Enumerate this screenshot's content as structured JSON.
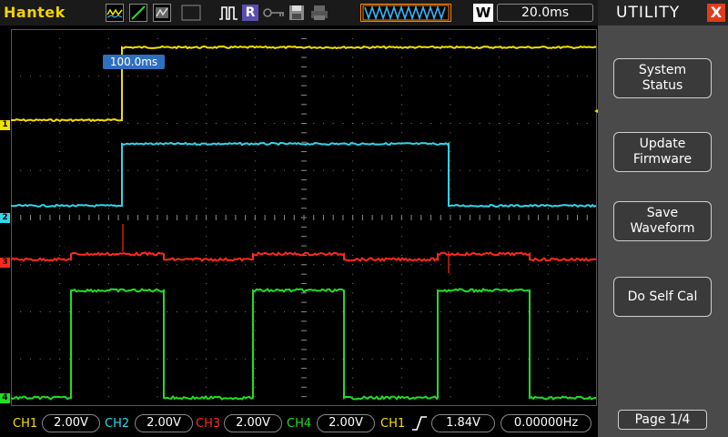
{
  "app": {
    "brand": "Hantek"
  },
  "toolbar": {
    "run_mode_label": "R",
    "w_label": "W",
    "timebase": "20.0ms"
  },
  "screen": {
    "trigger_position": "100.0ms",
    "channel_markers": [
      "1",
      "2",
      "3",
      "4"
    ]
  },
  "colors": {
    "ch1": "#f2e000",
    "ch2": "#2fd6ea",
    "ch3": "#ff2a1a",
    "ch4": "#22dd22"
  },
  "status": {
    "ch1_label": "CH1",
    "ch1_scale": "2.00V",
    "ch2_label": "CH2",
    "ch2_scale": "2.00V",
    "ch3_label": "CH3",
    "ch3_scale": "2.00V",
    "ch4_label": "CH4",
    "ch4_scale": "2.00V",
    "trigger_source": "CH1",
    "trigger_level": "1.84V",
    "frequency": "0.00000Hz"
  },
  "menu": {
    "title": "UTILITY",
    "close_label": "X",
    "buttons": [
      "System\nStatus",
      "Update\nFirmware",
      "Save\nWaveform",
      "Do Self Cal"
    ],
    "page": "Page 1/4"
  }
}
